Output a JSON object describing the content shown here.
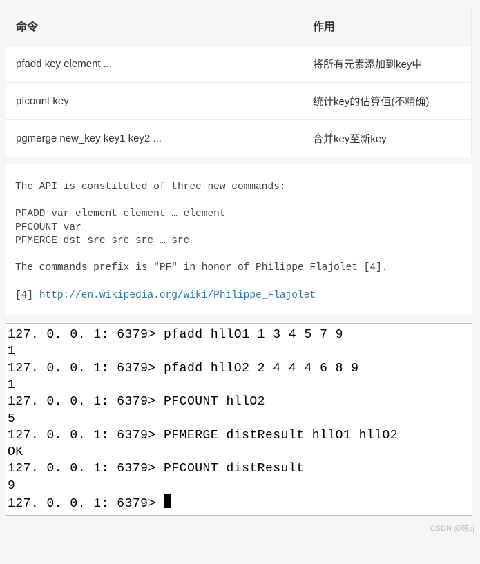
{
  "table": {
    "headers": [
      "命令",
      "作用"
    ],
    "rows": [
      {
        "cmd": "pfadd key element ...",
        "desc": "将所有元素添加到key中"
      },
      {
        "cmd": "pfcount key",
        "desc": "统计key的估算值(不精确)"
      },
      {
        "cmd": "pgmerge new_key key1 key2 ...",
        "desc": "合并key至新key"
      }
    ]
  },
  "api": {
    "intro": "The API is constituted of three new commands:",
    "l1": "PFADD var element element … element",
    "l2": "PFCOUNT var",
    "l3": "PFMERGE dst src src src … src",
    "note": "The commands prefix is \"PF\" in honor of Philippe Flajolet [4].",
    "ref_label": "[4] ",
    "ref_url": "http://en.wikipedia.org/wiki/Philippe_Flajolet"
  },
  "terminal": {
    "prompt": "127. 0. 0. 1: 6379> ",
    "lines": [
      {
        "cmd": "pfadd hllO1 1 3 4 5 7 9"
      },
      {
        "out": "1"
      },
      {
        "cmd": "pfadd hllO2 2 4 4 4 6 8 9"
      },
      {
        "out": "1"
      },
      {
        "cmd": "PFCOUNT hllO2"
      },
      {
        "out": "5"
      },
      {
        "cmd": "PFMERGE distResult hllO1 hllO2"
      },
      {
        "out": "OK"
      },
      {
        "cmd": "PFCOUNT distResult"
      },
      {
        "out": "9"
      },
      {
        "cmd": ""
      }
    ]
  },
  "watermark": "CSDN @韩zj"
}
